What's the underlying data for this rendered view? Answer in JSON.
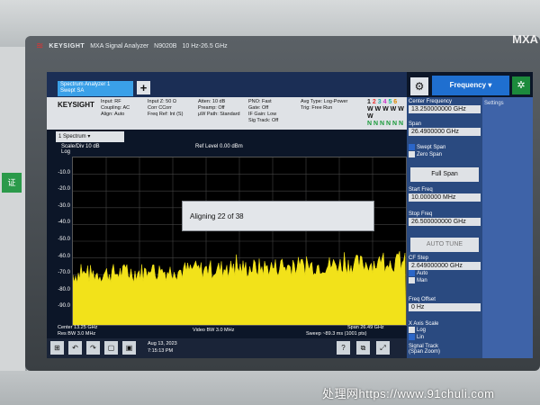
{
  "device": {
    "brand": "KEYSIGHT",
    "model": "MXA Signal Analyzer",
    "model_no": "N9020B",
    "range": "10 Hz-26.5 GHz",
    "series": "MXA"
  },
  "side_device": {
    "tag": "证"
  },
  "tab": {
    "label_1": "Spectrum Analyzer 1",
    "label_2": "Swept SA"
  },
  "header": {
    "brand": "KEYSIGHT",
    "input": "Input: RF",
    "coupling": "Coupling: AC",
    "align": "Align: Auto",
    "input_z": "Input Z: 50 Ω",
    "corr": "Corr CCorr",
    "freq_ref": "Freq Ref: Int (S)",
    "atten": "Atten: 10 dB",
    "preamp": "Preamp: Off",
    "mu_path": "µW Path: Standard",
    "pno": "PNO: Fast",
    "gate": "Gate: Off",
    "if_gain": "IF Gain: Low",
    "sig_track": "Sig Track: Off",
    "avg_type": "Avg Type: Log-Power",
    "trig": "Trig: Free Run",
    "trace_nums": [
      "1",
      "2",
      "3",
      "4",
      "5",
      "6"
    ],
    "trace_row2": "W W W W W W",
    "trace_row3": "N N N N N N"
  },
  "trace_label": "1 Spectrum",
  "scale": {
    "line1": "Scale/Div 10 dB",
    "line2": "Log"
  },
  "ref_level": "Ref Level 0.00 dBm",
  "y_ticks": [
    "-10.0",
    "-20.0",
    "-30.0",
    "-40.0",
    "-50.0",
    "-60.0",
    "-70.0",
    "-80.0",
    "-90.0"
  ],
  "dialog": {
    "text": "Aligning 22 of 38"
  },
  "footer": {
    "center": "Center 13.25 GHz",
    "res_bw": "Res BW 3.0 MHz",
    "video_bw": "Video BW 3.0 MHz",
    "span": "Span 26.49 GHz",
    "sweep": "Sweep ~89.3 ms (1001 pts)"
  },
  "datetime": {
    "date": "Aug 13, 2023",
    "time": "7:15:13 PM"
  },
  "controls": {
    "frequency": "Frequency",
    "settings": "Settings"
  },
  "panel": {
    "center_freq": {
      "label": "Center Frequency",
      "value": "13.250000000 GHz"
    },
    "span": {
      "label": "Span",
      "value": "26.4900000 GHz"
    },
    "swept": {
      "line1": "Swept Span",
      "line2": "Zero Span"
    },
    "full_span": "Full Span",
    "start_freq": {
      "label": "Start Freq",
      "value": "10.000000 MHz"
    },
    "stop_freq": {
      "label": "Stop Freq",
      "value": "26.500000000 GHz"
    },
    "auto_tune": "AUTO TUNE",
    "cf_step": {
      "label": "CF Step",
      "value": "2.649000000 GHz",
      "auto": "Auto",
      "man": "Man"
    },
    "freq_offset": {
      "label": "Freq Offset",
      "value": "0 Hz"
    },
    "x_axis": {
      "label": "X Axis Scale",
      "log": "Log",
      "lin": "Lin"
    },
    "signal_track": {
      "label": "Signal Track",
      "sub": "(Span Zoom)"
    }
  },
  "watermark": "处理网https://www.91chuli.com",
  "colors": {
    "trace": "#f2e21a",
    "panel": "#2a4a80",
    "accent": "#1f6fd0"
  }
}
